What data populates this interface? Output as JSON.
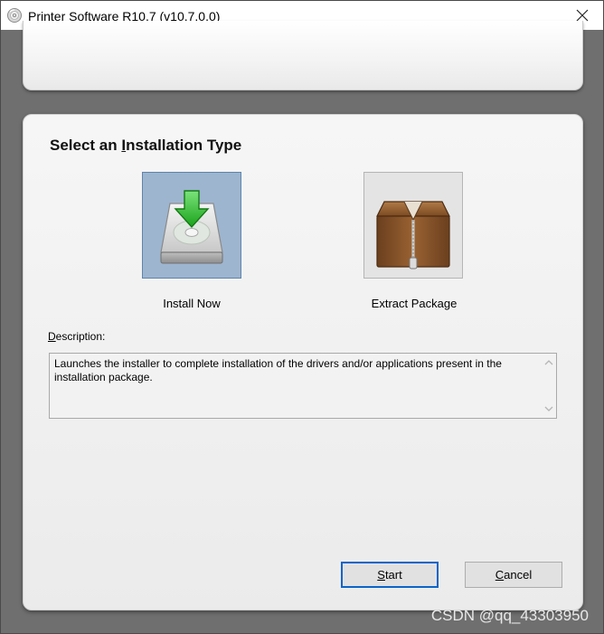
{
  "window": {
    "title": "Printer Software R10.7 (v10.7.0.0)"
  },
  "heading": {
    "pre": "Select an ",
    "accel": "I",
    "post": "nstallation Type"
  },
  "options": [
    {
      "label": "Install Now",
      "icon": "install-disk-icon",
      "selected": true
    },
    {
      "label": "Extract Package",
      "icon": "zip-package-icon",
      "selected": false
    }
  ],
  "description": {
    "label_accel": "D",
    "label_rest": "escription:",
    "text": "Launches the installer to complete installation of the drivers and/or applications present in the installation package."
  },
  "buttons": {
    "start_accel": "S",
    "start_rest": "tart",
    "cancel_accel": "C",
    "cancel_rest": "ancel"
  },
  "watermark": "CSDN @qq_43303950",
  "colors": {
    "selected_tile": "#9db5cf",
    "default_button_border": "#0a64c8",
    "install_arrow": "#2db82d"
  }
}
